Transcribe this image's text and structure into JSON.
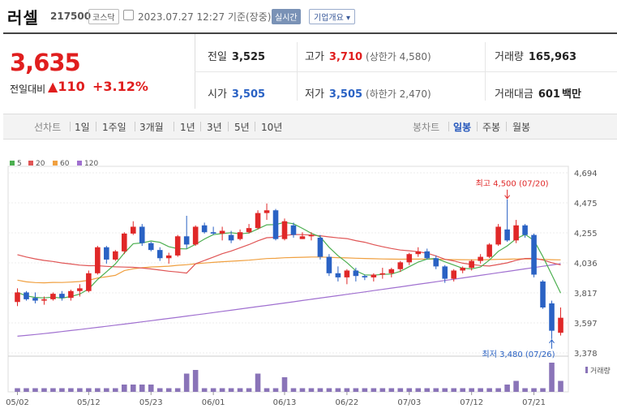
{
  "header": {
    "name": "러셀",
    "code": "217500",
    "market": "코스닥",
    "datetime": "2023.07.27 12:27 기준(장중)",
    "realtime": "실시간",
    "company_info": "기업개요"
  },
  "quote": {
    "price": "3,635",
    "compare_label": "전일대비",
    "change": "110",
    "change_pct": "+3.12%"
  },
  "stats": {
    "prev_label": "전일",
    "prev": "3,525",
    "high_label": "고가",
    "high": "3,710",
    "upper_limit": "(상한가 4,580)",
    "volume_label": "거래량",
    "volume": "165,963",
    "open_label": "시가",
    "open": "3,505",
    "low_label": "저가",
    "low": "3,505",
    "lower_limit": "(하한가 2,470)",
    "amount_label": "거래대금",
    "amount": "601",
    "amount_unit": "백만"
  },
  "tabs": {
    "line_label": "선차트",
    "periods": [
      "1일",
      "1주일",
      "3개월",
      "1년",
      "3년",
      "5년",
      "10년"
    ],
    "candle_label": "봉차트",
    "candle_periods": [
      "일봉",
      "주봉",
      "월봉"
    ],
    "selected_candle": "일봉"
  },
  "chart_data": {
    "type": "candlestick",
    "legend": [
      {
        "name": "5",
        "color": "#4caf50"
      },
      {
        "name": "20",
        "color": "#e05555"
      },
      {
        "name": "60",
        "color": "#f0a040"
      },
      {
        "name": "120",
        "color": "#a070d0"
      }
    ],
    "y_ticks": [
      3378,
      3597,
      3817,
      4036,
      4255,
      4475,
      4694
    ],
    "ylim": [
      3378,
      4694
    ],
    "x_labels": [
      "05/02",
      "05/12",
      "05/23",
      "06/01",
      "06/13",
      "06/22",
      "07/03",
      "07/12",
      "07/21"
    ],
    "x_label_index": [
      0,
      8,
      15,
      22,
      30,
      37,
      44,
      51,
      58
    ],
    "colors": {
      "up": "#e02828",
      "down": "#2a62c4",
      "ma5": "#4caf50",
      "ma20": "#e05555",
      "ma60": "#f0a040",
      "ma120": "#a070d0"
    },
    "candles": [
      [
        3750,
        3850,
        3720,
        3820
      ],
      [
        3820,
        3830,
        3760,
        3770
      ],
      [
        3780,
        3820,
        3740,
        3760
      ],
      [
        3760,
        3790,
        3730,
        3770
      ],
      [
        3770,
        3820,
        3760,
        3810
      ],
      [
        3810,
        3830,
        3760,
        3780
      ],
      [
        3780,
        3840,
        3760,
        3830
      ],
      [
        3830,
        3880,
        3790,
        3850
      ],
      [
        3830,
        3980,
        3820,
        3960
      ],
      [
        3960,
        4160,
        3950,
        4150
      ],
      [
        4150,
        4160,
        4030,
        4060
      ],
      [
        4060,
        4130,
        4050,
        4120
      ],
      [
        4120,
        4260,
        4100,
        4250
      ],
      [
        4250,
        4340,
        4240,
        4300
      ],
      [
        4300,
        4320,
        4160,
        4180
      ],
      [
        4180,
        4190,
        4120,
        4130
      ],
      [
        4130,
        4150,
        4050,
        4070
      ],
      [
        4070,
        4110,
        4030,
        4090
      ],
      [
        4090,
        4240,
        4080,
        4230
      ],
      [
        4230,
        4380,
        4140,
        4170
      ],
      [
        4170,
        4310,
        4160,
        4300
      ],
      [
        4310,
        4330,
        4250,
        4260
      ],
      [
        4260,
        4300,
        4240,
        4250
      ],
      [
        4250,
        4300,
        4200,
        4270
      ],
      [
        4240,
        4270,
        4180,
        4200
      ],
      [
        4210,
        4280,
        4200,
        4260
      ],
      [
        4260,
        4320,
        4250,
        4290
      ],
      [
        4290,
        4420,
        4280,
        4400
      ],
      [
        4400,
        4470,
        4350,
        4420
      ],
      [
        4420,
        4430,
        4200,
        4210
      ],
      [
        4210,
        4360,
        4200,
        4340
      ],
      [
        4310,
        4330,
        4220,
        4240
      ],
      [
        4210,
        4260,
        4210,
        4230
      ],
      [
        4230,
        4260,
        4200,
        4240
      ],
      [
        4220,
        4240,
        4060,
        4080
      ],
      [
        4080,
        4100,
        3940,
        3960
      ],
      [
        3960,
        4010,
        3900,
        3930
      ],
      [
        3930,
        3990,
        3880,
        3980
      ],
      [
        3980,
        4000,
        3900,
        3940
      ],
      [
        3940,
        3950,
        3910,
        3930
      ],
      [
        3930,
        3960,
        3900,
        3950
      ],
      [
        3950,
        4000,
        3920,
        3960
      ],
      [
        3960,
        4000,
        3930,
        3990
      ],
      [
        3990,
        4050,
        3970,
        4040
      ],
      [
        4040,
        4110,
        4020,
        4100
      ],
      [
        4100,
        4150,
        4080,
        4120
      ],
      [
        4120,
        4140,
        4060,
        4070
      ],
      [
        4070,
        4090,
        3990,
        4010
      ],
      [
        4010,
        4020,
        3890,
        3920
      ],
      [
        3920,
        3990,
        3900,
        3980
      ],
      [
        3980,
        4010,
        3960,
        4000
      ],
      [
        4000,
        4060,
        3980,
        4050
      ],
      [
        4050,
        4100,
        4030,
        4080
      ],
      [
        4080,
        4180,
        4070,
        4170
      ],
      [
        4170,
        4320,
        4160,
        4300
      ],
      [
        4280,
        4500,
        4190,
        4200
      ],
      [
        4200,
        4350,
        4180,
        4310
      ],
      [
        4310,
        4320,
        4220,
        4240
      ],
      [
        4240,
        4250,
        3930,
        3950
      ],
      [
        3900,
        3910,
        3700,
        3710
      ],
      [
        3740,
        3760,
        3480,
        3540
      ],
      [
        3525,
        3710,
        3505,
        3635
      ]
    ],
    "volume": [
      1,
      1,
      1,
      1,
      1,
      1,
      1,
      1,
      1,
      1,
      1,
      1,
      2,
      2,
      2,
      2,
      1,
      1,
      1,
      5,
      6,
      1,
      1,
      1,
      1,
      1,
      1,
      5,
      1,
      1,
      4,
      1,
      1,
      1,
      1,
      1,
      1,
      1,
      1,
      1,
      1,
      1,
      1,
      1,
      1,
      1,
      1,
      1,
      1,
      1,
      1,
      1,
      1,
      1,
      1,
      2,
      3,
      1,
      1,
      1,
      8,
      3,
      3,
      2,
      2,
      1
    ],
    "annotations": {
      "high": "최고 4,500 (07/20)",
      "low": "최저 3,480 (07/26)"
    },
    "volume_label": "거래량"
  }
}
